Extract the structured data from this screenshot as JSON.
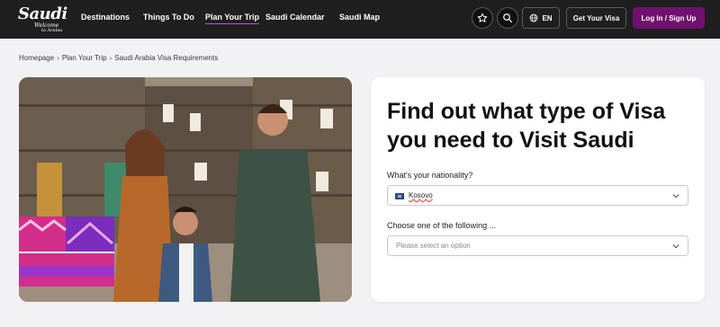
{
  "header": {
    "logo": {
      "line1": "Saudi",
      "line2": "Welcome",
      "line3": "to Arabia"
    },
    "nav": [
      {
        "label": "Destinations"
      },
      {
        "label": "Things To Do"
      },
      {
        "label": "Plan Your Trip",
        "active": true
      },
      {
        "label": "Saudi Calendar"
      },
      {
        "label": "Saudi Map"
      }
    ],
    "icons": {
      "favorites": "star-icon",
      "search": "search-icon",
      "language": "globe-icon"
    },
    "language_label": "EN",
    "visa_button": "Get Your Visa",
    "login_button": "Log In / Sign Up",
    "accent_color": "#70116d"
  },
  "breadcrumb": [
    "Homepage",
    "Plan Your Trip",
    "Saudi Arabia Visa Requirements"
  ],
  "visa_card": {
    "title": "Find out what type of Visa you need to Visit Saudi",
    "nationality_label": "What's your nationality?",
    "nationality_value": "Kosovo",
    "option_label": "Choose one of the following ...",
    "option_placeholder": "Please select an option"
  }
}
